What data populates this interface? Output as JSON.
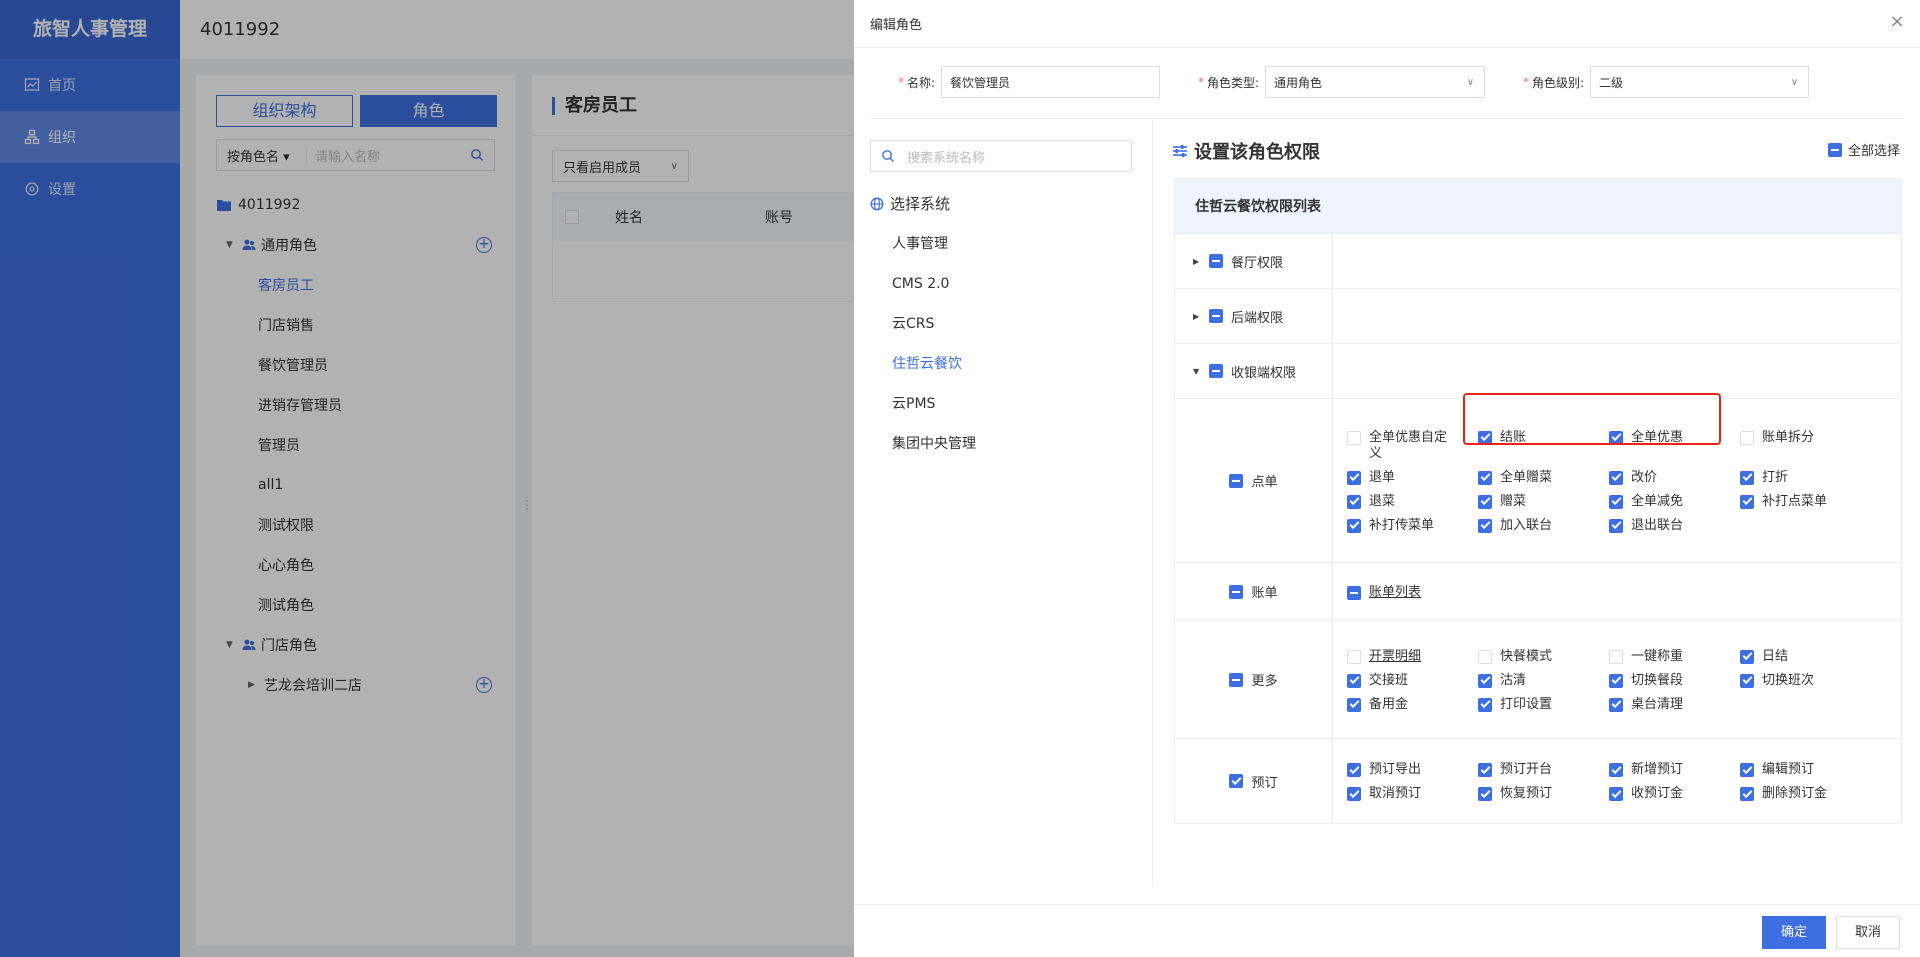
{
  "app": {
    "title": "旅智人事管理",
    "nav": [
      {
        "label": "首页",
        "icon": "chart-icon"
      },
      {
        "label": "组织",
        "icon": "org-icon"
      },
      {
        "label": "设置",
        "icon": "gear-icon"
      }
    ]
  },
  "topbar": {
    "org_id": "4011992"
  },
  "left_panel": {
    "tabs": [
      "组织架构",
      "角色"
    ],
    "search": {
      "mode": "按角色名",
      "placeholder": "请输入名称"
    },
    "tree": {
      "root": "4011992",
      "general_group": "通用角色",
      "general_roles": [
        "客房员工",
        "门店销售",
        "餐饮管理员",
        "进销存管理员",
        "管理员",
        "all1",
        "测试权限",
        "心心角色",
        "测试角色"
      ],
      "store_group": "门店角色",
      "store_child": "艺龙会培训二店"
    }
  },
  "right_panel": {
    "title": "客房员工",
    "filter": "只看启用成员",
    "columns": [
      "姓名",
      "账号"
    ]
  },
  "drawer": {
    "title": "编辑角色",
    "close": "×",
    "form": {
      "name_label": "名称:",
      "name_value": "餐饮管理员",
      "type_label": "角色类型:",
      "type_value": "通用角色",
      "level_label": "角色级别:",
      "level_value": "二级"
    },
    "systems": {
      "search_placeholder": "搜索系统名称",
      "title": "选择系统",
      "items": [
        "人事管理",
        "CMS 2.0",
        "云CRS",
        "住哲云餐饮",
        "云PMS",
        "集团中央管理"
      ],
      "active_index": 3
    },
    "permissions": {
      "title": "设置该角色权限",
      "select_all": "全部选择",
      "table_title": "住哲云餐饮权限列表",
      "groups": [
        "餐厅权限",
        "后端权限",
        "收银端权限"
      ],
      "categories": [
        {
          "name": "点单",
          "items": [
            {
              "label": "全单优惠自定义",
              "checked": false
            },
            {
              "label": "结账",
              "checked": true
            },
            {
              "label": "全单优惠",
              "checked": true
            },
            {
              "label": "账单拆分",
              "checked": false
            },
            {
              "label": "退单",
              "checked": true
            },
            {
              "label": "全单赠菜",
              "checked": true
            },
            {
              "label": "改价",
              "checked": true
            },
            {
              "label": "打折",
              "checked": true
            },
            {
              "label": "退菜",
              "checked": true
            },
            {
              "label": "赠菜",
              "checked": true
            },
            {
              "label": "全单减免",
              "checked": true
            },
            {
              "label": "补打点菜单",
              "checked": true
            },
            {
              "label": "补打传菜单",
              "checked": true
            },
            {
              "label": "加入联台",
              "checked": true
            },
            {
              "label": "退出联台",
              "checked": true
            }
          ]
        },
        {
          "name": "账单",
          "items": [
            {
              "label": "账单列表",
              "checked": "half"
            }
          ]
        },
        {
          "name": "更多",
          "items": [
            {
              "label": "开票明细",
              "checked": false
            },
            {
              "label": "快餐模式",
              "checked": false
            },
            {
              "label": "一键称重",
              "checked": false
            },
            {
              "label": "日结",
              "checked": true
            },
            {
              "label": "交接班",
              "checked": true
            },
            {
              "label": "沽清",
              "checked": true
            },
            {
              "label": "切换餐段",
              "checked": true
            },
            {
              "label": "切换班次",
              "checked": true
            },
            {
              "label": "备用金",
              "checked": true
            },
            {
              "label": "打印设置",
              "checked": true
            },
            {
              "label": "桌台清理",
              "checked": true
            }
          ]
        },
        {
          "name": "预订",
          "items": [
            {
              "label": "预订导出",
              "checked": true
            },
            {
              "label": "预订开台",
              "checked": true
            },
            {
              "label": "新增预订",
              "checked": true
            },
            {
              "label": "编辑预订",
              "checked": true
            },
            {
              "label": "取消预订",
              "checked": true
            },
            {
              "label": "恢复预订",
              "checked": true
            },
            {
              "label": "收预订金",
              "checked": true
            },
            {
              "label": "删除预订金",
              "checked": true
            }
          ]
        }
      ]
    },
    "footer": {
      "ok": "确定",
      "cancel": "取消"
    }
  },
  "colors": {
    "primary": "#3d6fe0",
    "highlight": "#e8241c"
  }
}
